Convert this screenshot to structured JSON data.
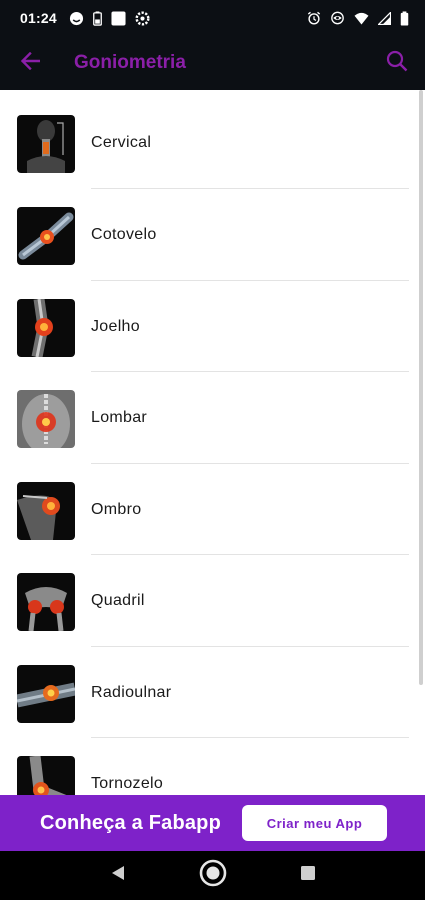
{
  "status_bar": {
    "time": "01:24",
    "left_icons": [
      "face-icon",
      "battery-saver-icon",
      "square-app-icon",
      "settings-icon"
    ],
    "right_icons": [
      "alarm-icon",
      "eye-icon",
      "wifi-icon",
      "signal-icon",
      "battery-icon"
    ]
  },
  "app_bar": {
    "title": "Goniometria",
    "back_icon": "arrow-left-icon",
    "search_icon": "search-icon",
    "accent_color": "#8b1fa8"
  },
  "list": {
    "items": [
      {
        "label": "Cervical",
        "icon": "cervical-image"
      },
      {
        "label": "Cotovelo",
        "icon": "elbow-image"
      },
      {
        "label": "Joelho",
        "icon": "knee-image"
      },
      {
        "label": "Lombar",
        "icon": "lumbar-image"
      },
      {
        "label": "Ombro",
        "icon": "shoulder-image"
      },
      {
        "label": "Quadril",
        "icon": "hip-image"
      },
      {
        "label": "Radioulnar",
        "icon": "forearm-image"
      },
      {
        "label": "Tornozelo",
        "icon": "ankle-image"
      }
    ]
  },
  "promo": {
    "text": "Conheça a Fabapp",
    "button_label": "Criar meu App",
    "background_color": "#7e22c9"
  },
  "nav_bar": {
    "buttons": [
      "back-triangle-icon",
      "home-circle-icon",
      "recents-square-icon"
    ]
  }
}
